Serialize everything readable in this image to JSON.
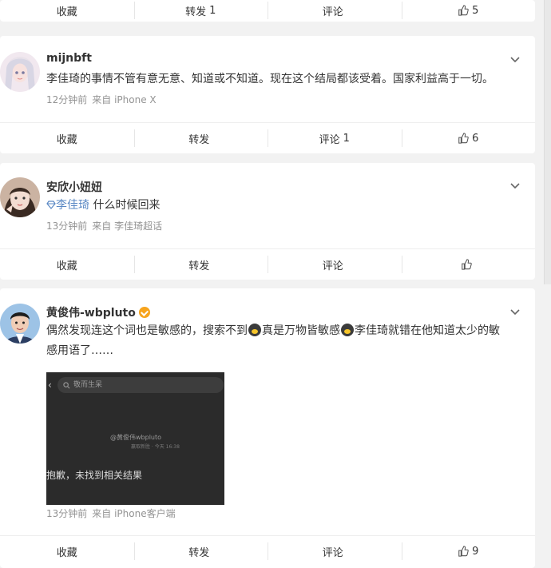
{
  "cards": [
    {
      "actions": {
        "fav": "收藏",
        "repost": "转发",
        "repost_count": "1",
        "comment": "评论",
        "comment_count": "",
        "like_count": "5"
      }
    },
    {
      "username": "mijnbft",
      "text": "李佳琦的事情不管有意无意、知道或不知道。现在这个结局都该受着。国家利益高于一切。",
      "time": "12分钟前",
      "source": "来自 iPhone X",
      "actions": {
        "fav": "收藏",
        "repost": "转发",
        "repost_count": "",
        "comment": "评论",
        "comment_count": "1",
        "like_count": "6"
      }
    },
    {
      "username": "安欣小妞妞",
      "topic": "李佳琦",
      "text": " 什么时候回来",
      "time": "13分钟前",
      "source": "来自 李佳琦超话",
      "actions": {
        "fav": "收藏",
        "repost": "转发",
        "repost_count": "",
        "comment": "评论",
        "comment_count": "",
        "like_count": ""
      }
    },
    {
      "username": "黄俊伟-wbpluto",
      "text_a": "偶然发现连这个词也是敏感的，搜索不到",
      "text_b": "真是万物皆敏感",
      "text_c": "李佳琦就错在他知道太少的敏",
      "text_d": "感用语了……",
      "media": {
        "search": "敬而生呆",
        "watermark": "@黄俊伟wbpluto",
        "watermark_sub": "赢取新胜 · 今天 16:38",
        "empty": "抱歉，未找到相关结果"
      },
      "time": "13分钟前",
      "source": "来自 iPhone客户端",
      "actions": {
        "fav": "收藏",
        "repost": "转发",
        "repost_count": "",
        "comment": "评论",
        "comment_count": "",
        "like_count": "9"
      }
    }
  ],
  "icons": {
    "like": "thumbs-up-icon",
    "more": "chevron-down-icon",
    "verified": "vip-badge-icon",
    "topic": "diamond-icon",
    "emoji": "scream-emoji-icon"
  }
}
